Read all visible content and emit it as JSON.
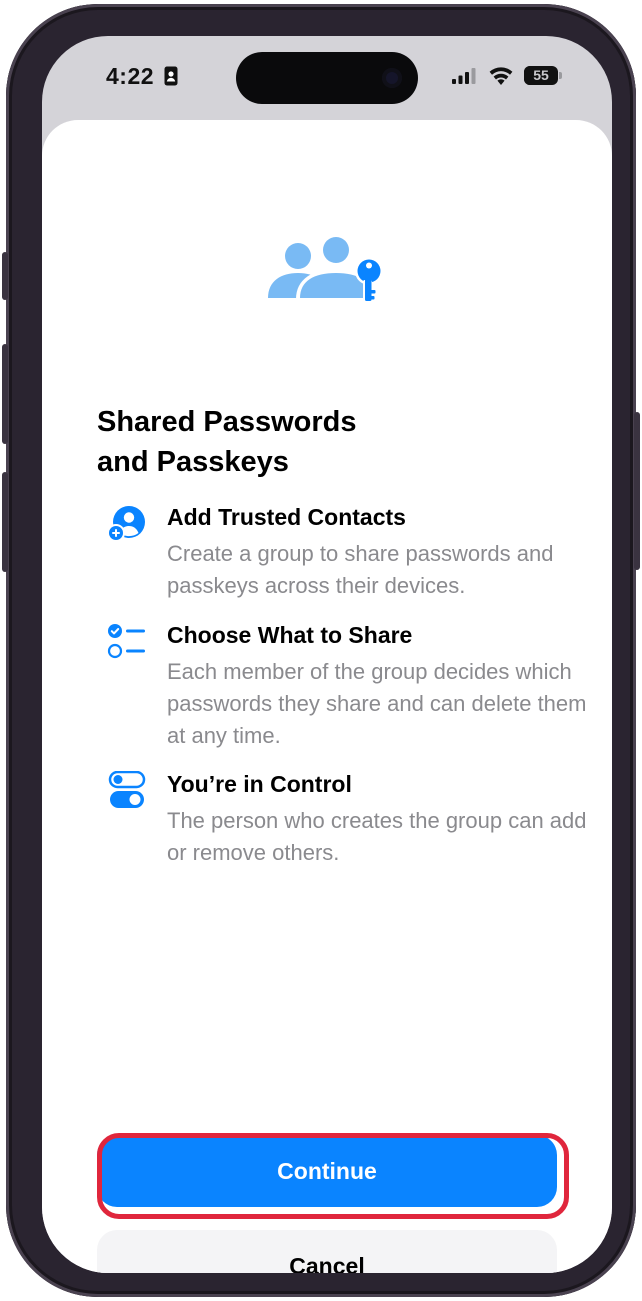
{
  "status_bar": {
    "time": "4:22",
    "battery": "55"
  },
  "sheet": {
    "title_line1": "Shared Passwords",
    "title_line2": "and Passkeys",
    "features": [
      {
        "icon": "person-add-icon",
        "title": "Add Trusted Contacts",
        "description": "Create a group to share passwords and passkeys across their devices."
      },
      {
        "icon": "checklist-icon",
        "title": "Choose What to Share",
        "description": "Each member of the group decides which passwords they share and can delete them at any time."
      },
      {
        "icon": "toggles-icon",
        "title": "You’re in Control",
        "description": "The person who creates the group can add or remove others."
      }
    ],
    "continue_label": "Continue",
    "cancel_label": "Cancel"
  },
  "colors": {
    "accent": "#0a84ff",
    "hero_light": "#79baf4",
    "highlight": "#e0263c"
  }
}
